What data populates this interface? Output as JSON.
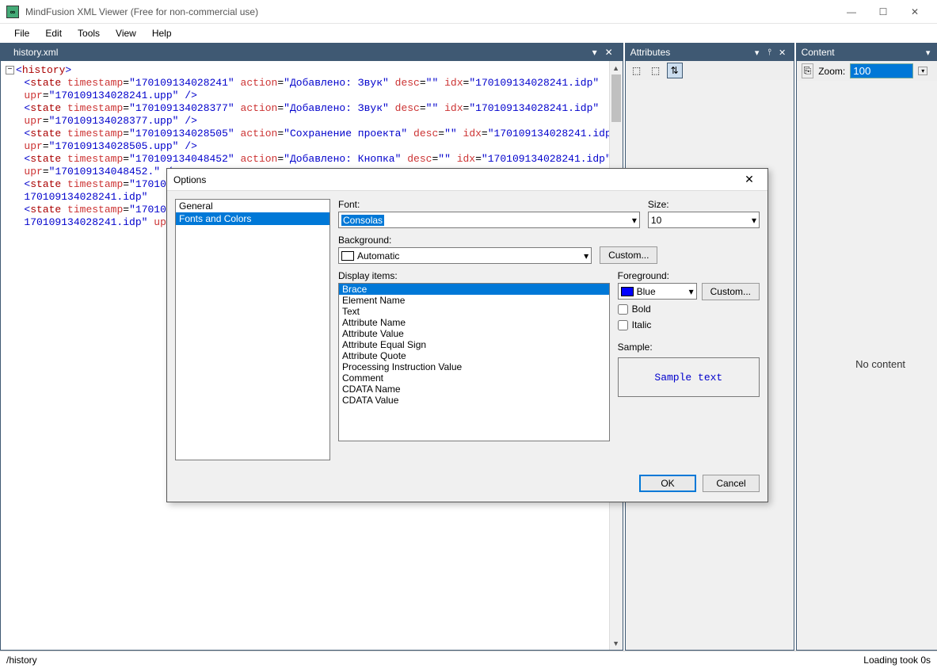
{
  "title": "MindFusion XML Viewer (Free for non-commercial use)",
  "menus": [
    "File",
    "Edit",
    "Tools",
    "View",
    "Help"
  ],
  "doc": {
    "tabname": "history.xml",
    "root": "history",
    "states": [
      {
        "timestamp": "170109134028241",
        "action": "Добавлено: Звук",
        "desc": "",
        "idx": "170109134028241.idp",
        "upr": "170109134028241.upp"
      },
      {
        "timestamp": "170109134028377",
        "action": "Добавлено: Звук",
        "desc": "",
        "idx": "170109134028241.idp",
        "upr": "170109134028377.upp"
      },
      {
        "timestamp": "170109134028505",
        "action": "Сохранение проекта",
        "desc": "",
        "idx": "170109134028241.idp",
        "upr": "170109134028505.upp"
      },
      {
        "timestamp": "170109134048452",
        "action": "Добавлено: Кнопка",
        "desc": "",
        "idx": "170109134028241.idp",
        "upr": "170109134048452."
      },
      {
        "timestamp": "17010",
        "partial": true,
        "idx_frag": "170109134028241.idp"
      },
      {
        "timestamp": "17010",
        "partial": true,
        "idx_frag": "170109134028241.idp",
        "up_frag": "up"
      }
    ]
  },
  "panels": {
    "attributes": {
      "title": "Attributes"
    },
    "content": {
      "title": "Content",
      "zoom_label": "Zoom:",
      "zoom_value": "100",
      "empty": "No content"
    }
  },
  "status": {
    "path": "/history",
    "loading": "Loading took 0s"
  },
  "dialog": {
    "title": "Options",
    "categories": [
      "General",
      "Fonts and Colors"
    ],
    "selected_category": 1,
    "font_label": "Font:",
    "font_value": "Consolas",
    "size_label": "Size:",
    "size_value": "10",
    "background_label": "Background:",
    "background_value": "Automatic",
    "custom_btn": "Custom...",
    "display_items_label": "Display items:",
    "display_items": [
      "Brace",
      "Element Name",
      "Text",
      "Attribute Name",
      "Attribute Value",
      "Attribute Equal Sign",
      "Attribute Quote",
      "Processing Instruction Value",
      "Comment",
      "CDATA Name",
      "CDATA Value"
    ],
    "selected_display_item": 0,
    "foreground_label": "Foreground:",
    "foreground_value": "Blue",
    "bold_label": "Bold",
    "italic_label": "Italic",
    "sample_label": "Sample:",
    "sample_text": "Sample text",
    "ok": "OK",
    "cancel": "Cancel"
  }
}
